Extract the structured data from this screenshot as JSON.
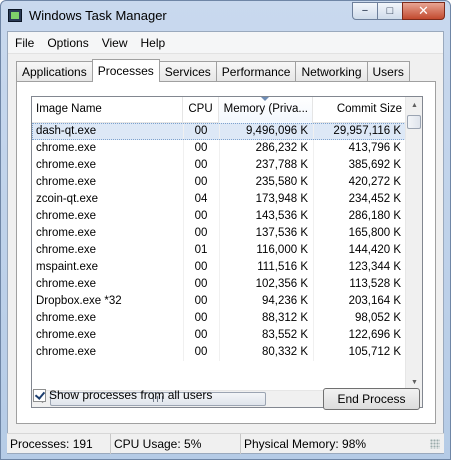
{
  "window": {
    "title": "Windows Task Manager"
  },
  "caption": {
    "minimize": "−",
    "maximize": "□",
    "close": "✕"
  },
  "menu": [
    "File",
    "Options",
    "View",
    "Help"
  ],
  "tabs": [
    "Applications",
    "Processes",
    "Services",
    "Performance",
    "Networking",
    "Users"
  ],
  "active_tab": "Processes",
  "columns": {
    "name": "Image Name",
    "cpu": "CPU",
    "memory": "Memory (Priva...",
    "commit": "Commit Size"
  },
  "rows": [
    {
      "name": "dash-qt.exe",
      "cpu": "00",
      "memory": "9,496,096 K",
      "commit": "29,957,116 K",
      "selected": true
    },
    {
      "name": "chrome.exe",
      "cpu": "00",
      "memory": "286,232 K",
      "commit": "413,796 K"
    },
    {
      "name": "chrome.exe",
      "cpu": "00",
      "memory": "237,788 K",
      "commit": "385,692 K"
    },
    {
      "name": "chrome.exe",
      "cpu": "00",
      "memory": "235,580 K",
      "commit": "420,272 K"
    },
    {
      "name": "zcoin-qt.exe",
      "cpu": "04",
      "memory": "173,948 K",
      "commit": "234,452 K"
    },
    {
      "name": "chrome.exe",
      "cpu": "00",
      "memory": "143,536 K",
      "commit": "286,180 K"
    },
    {
      "name": "chrome.exe",
      "cpu": "00",
      "memory": "137,536 K",
      "commit": "165,800 K"
    },
    {
      "name": "chrome.exe",
      "cpu": "01",
      "memory": "116,000 K",
      "commit": "144,420 K"
    },
    {
      "name": "mspaint.exe",
      "cpu": "00",
      "memory": "111,516 K",
      "commit": "123,344 K"
    },
    {
      "name": "chrome.exe",
      "cpu": "00",
      "memory": "102,356 K",
      "commit": "113,528 K"
    },
    {
      "name": "Dropbox.exe *32",
      "cpu": "00",
      "memory": "94,236 K",
      "commit": "203,164 K"
    },
    {
      "name": "chrome.exe",
      "cpu": "00",
      "memory": "88,312 K",
      "commit": "98,052 K"
    },
    {
      "name": "chrome.exe",
      "cpu": "00",
      "memory": "83,552 K",
      "commit": "122,696 K"
    },
    {
      "name": "chrome.exe",
      "cpu": "00",
      "memory": "80,332 K",
      "commit": "105,712 K"
    }
  ],
  "scrollbar": {
    "up": "▲",
    "down": "▼",
    "left": "◀",
    "right": "▶"
  },
  "show_all_users": {
    "label": "Show processes from all users",
    "checked": true
  },
  "end_process": "End Process",
  "status": {
    "processes": "Processes: 191",
    "cpu": "CPU Usage: 5%",
    "memory": "Physical Memory: 98%"
  }
}
